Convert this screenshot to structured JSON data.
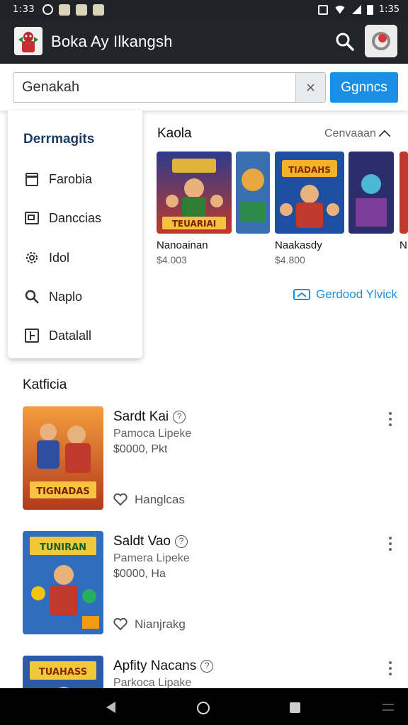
{
  "status_bar": {
    "time": "1:33",
    "clock_right": "1:35"
  },
  "app_bar": {
    "title": "Boka Ay Ilkangsh",
    "search_icon": "search-icon",
    "avatar_icon": "avatar"
  },
  "search": {
    "value": "Genakah",
    "placeholder": "",
    "clear_label": "×",
    "button_label": "Ggnncs"
  },
  "dropdown": {
    "title": "Derrmagits",
    "items": [
      {
        "label": "Farobia",
        "icon": "document-icon"
      },
      {
        "label": "Danccias",
        "icon": "layers-icon"
      },
      {
        "label": "Idol",
        "icon": "gear-icon"
      },
      {
        "label": "Naplo",
        "icon": "search-icon"
      },
      {
        "label": "Datalall",
        "icon": "grid-icon"
      }
    ]
  },
  "featured": {
    "title": "Kaola",
    "toggle_label": "Cenvaaan",
    "cards": [
      {
        "title": "Nanoainan",
        "price": "$4.003"
      },
      {
        "title": "",
        "price": ""
      },
      {
        "title": "Naakasdy",
        "price": "$4.800"
      },
      {
        "title": "",
        "price": ""
      },
      {
        "title": "N",
        "price": ""
      }
    ],
    "link_label": "Gerdood Ylvick"
  },
  "list": {
    "title": "Katficia",
    "items": [
      {
        "name": "Sardt Kai",
        "subtitle": "Pamoca Lipeke",
        "price": "$0000, Pkt",
        "fav_label": "Hanglcas",
        "thumb_text": "TIGNADAS"
      },
      {
        "name": "Saldt Vao",
        "subtitle": "Pamera Lipeke",
        "price": "$0000, Ha",
        "fav_label": "Nianjrakg",
        "thumb_text": "TUNIRAN"
      },
      {
        "name": "Apfity Nacans",
        "subtitle": "Parkoca Lipake",
        "price": "",
        "fav_label": "",
        "thumb_text": "TUAHASS"
      }
    ]
  },
  "colors": {
    "accent": "#1a8fe3",
    "app_bar": "#212529",
    "status_bar": "#1f2327"
  }
}
